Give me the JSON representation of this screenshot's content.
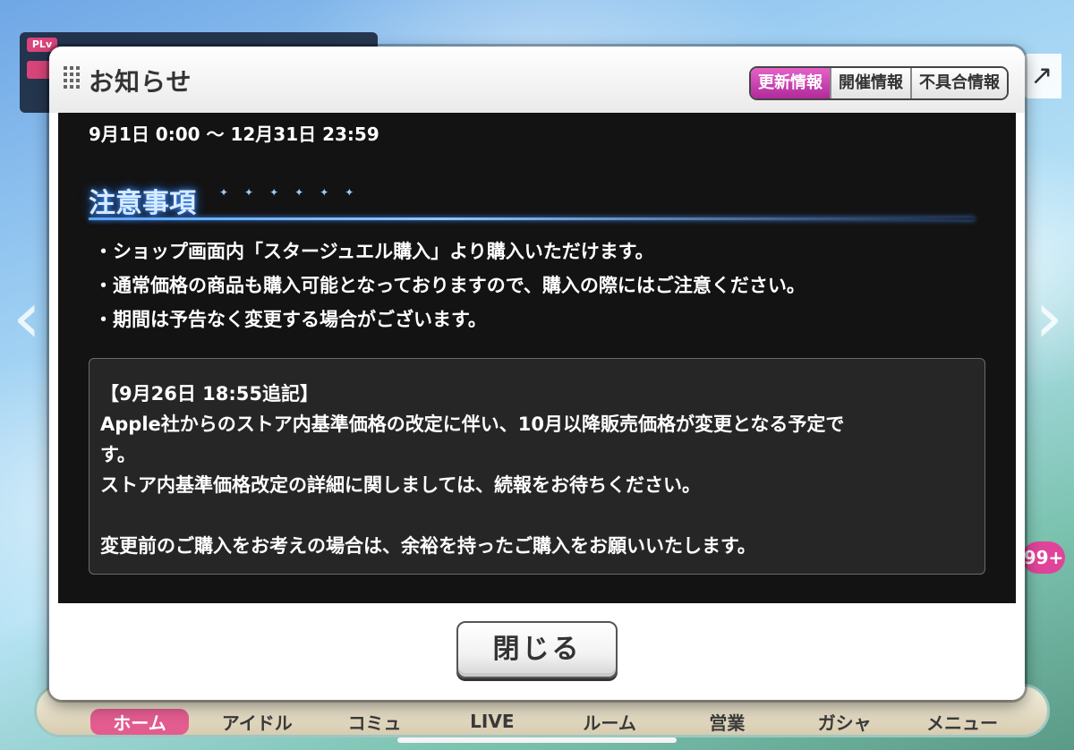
{
  "background": {
    "plv_label": "PLv",
    "side_arrow_left": "‹",
    "side_arrow_right": "›",
    "share_icon_glyph": "↗",
    "notification_count": "99+",
    "nav": [
      "ホーム",
      "アイドル",
      "コミュ",
      "LIVE",
      "ルーム",
      "営業",
      "ガシャ",
      "メニュー"
    ]
  },
  "dialog": {
    "title": "お知らせ",
    "tabs": [
      {
        "label": "更新情報",
        "active": true
      },
      {
        "label": "開催情報",
        "active": false
      },
      {
        "label": "不具合情報",
        "active": false
      }
    ],
    "period": "9月1日 0:00 〜 12月31日 23:59",
    "section_title": "注意事項",
    "notes": [
      "・ショップ画面内「スタージュエル購入」より購入いただけます。",
      "・通常価格の商品も購入可能となっておりますので、購入の際にはご注意ください。",
      "・期間は予告なく変更する場合がございます。"
    ],
    "notice": {
      "heading": "【9月26日 18:55追記】",
      "line1": "Apple社からのストア内基準価格の改定に伴い、10月以降販売価格が変更となる予定で",
      "line2": "す。",
      "line3": "ストア内基準価格改定の詳細に関しましては、続報をお待ちください。",
      "line4": "変更前のご購入をお考えの場合は、余裕を持ったご購入をお願いいたします。"
    },
    "close_label": "閉じる"
  },
  "colors": {
    "active_tab": "#c83aa8",
    "body_bg": "#131313",
    "section_glow": "#3d8dff"
  }
}
